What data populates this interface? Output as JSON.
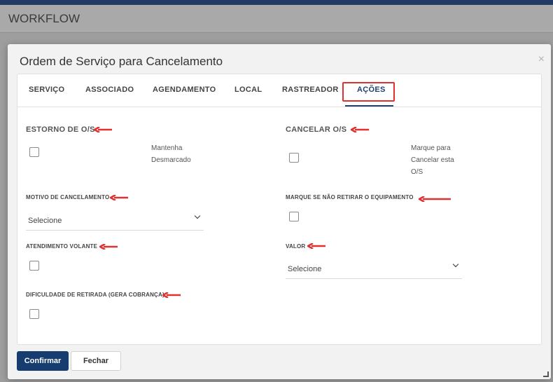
{
  "app": {
    "title": "WORKFLOW"
  },
  "modal": {
    "title": "Ordem de Serviço para Cancelamento",
    "close": "×",
    "tabs": [
      {
        "label": "SERVIÇO"
      },
      {
        "label": "ASSOCIADO"
      },
      {
        "label": "AGENDAMENTO"
      },
      {
        "label": "LOCAL"
      },
      {
        "label": "RASTREADOR"
      },
      {
        "label": "AÇÕES",
        "active": true
      }
    ],
    "sections": {
      "estorno": {
        "title": "ESTORNO DE O/S",
        "text": "Mantenha Desmarcado"
      },
      "cancelar": {
        "title": "CANCELAR O/S",
        "text": "Marque para Cancelar esta O/S"
      },
      "motivo": {
        "label": "MOTIVO DE CANCELAMENTO",
        "value": "Selecione"
      },
      "nao_retirar": {
        "label": "MARQUE SE NÃO RETIRAR O EQUIPAMENTO"
      },
      "atendimento": {
        "label": "ATENDIMENTO VOLANTE"
      },
      "valor": {
        "label": "VALOR",
        "value": "Selecione"
      },
      "dificuldade": {
        "label": "DIFICULDADE DE RETIRADA (GERA COBRANÇA)"
      }
    },
    "buttons": {
      "confirm": "Confirmar",
      "close": "Fechar"
    }
  },
  "colors": {
    "accent": "#173d70",
    "annotation": "#e03030"
  },
  "icons": [
    "close-icon",
    "chevron-down-icon",
    "arrow-annotation-icon",
    "resize-handle-icon"
  ]
}
